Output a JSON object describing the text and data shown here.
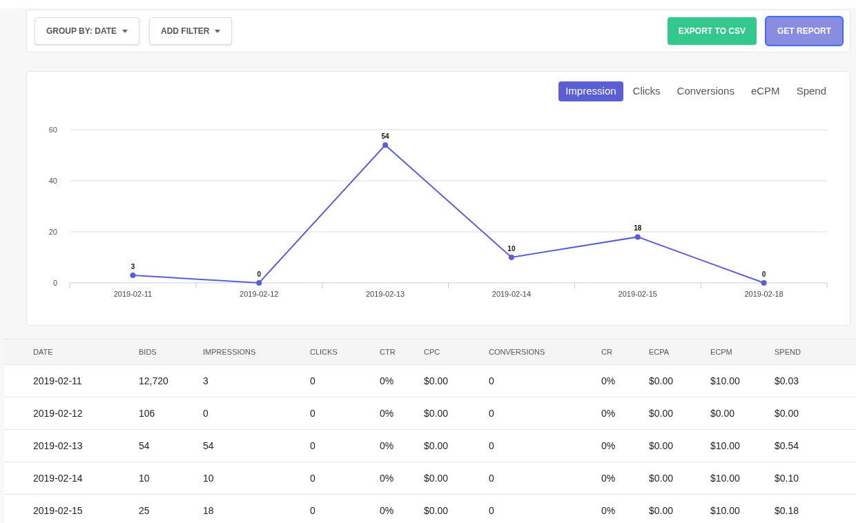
{
  "toolbar": {
    "left_buttons": [
      {
        "label": "GROUP BY: DATE"
      },
      {
        "label": "ADD FILTER"
      }
    ],
    "right_buttons": [
      {
        "label": "EXPORT TO CSV",
        "kind": "export"
      },
      {
        "label": "GET REPORT",
        "kind": "report"
      }
    ]
  },
  "chart_panel": {
    "tabs": [
      {
        "label": "Impression",
        "selected": true
      },
      {
        "label": "Clicks",
        "selected": false
      },
      {
        "label": "Conversions",
        "selected": false
      },
      {
        "label": "eCPM",
        "selected": false
      },
      {
        "label": "Spend",
        "selected": false
      }
    ],
    "chart_data": {
      "type": "line",
      "categories": [
        "2019-02-11",
        "2019-02-12",
        "2019-02-13",
        "2019-02-14",
        "2019-02-15",
        "2019-02-18"
      ],
      "series": [
        {
          "color": "#5b5fd6",
          "marker": "circle",
          "values": [
            3,
            0,
            54,
            10,
            18,
            0
          ]
        }
      ],
      "ylim": [
        0,
        60
      ],
      "yticks": [
        0,
        20,
        40,
        60
      ],
      "data_labels": true
    }
  },
  "table": {
    "columns": [
      "DATE",
      "BIDS",
      "IMPRESSIONS",
      "CLICKS",
      "CTR",
      "CPC",
      "CONVERSIONS",
      "CR",
      "ECPA",
      "ECPM",
      "SPEND"
    ],
    "rows": [
      [
        "2019-02-11",
        "12,720",
        "3",
        "0",
        "0%",
        "$0.00",
        "0",
        "0%",
        "$0.00",
        "$10.00",
        "$0.03"
      ],
      [
        "2019-02-12",
        "106",
        "0",
        "0",
        "0%",
        "$0.00",
        "0",
        "0%",
        "$0.00",
        "$0.00",
        "$0.00"
      ],
      [
        "2019-02-13",
        "54",
        "54",
        "0",
        "0%",
        "$0.00",
        "0",
        "0%",
        "$0.00",
        "$10.00",
        "$0.54"
      ],
      [
        "2019-02-14",
        "10",
        "10",
        "0",
        "0%",
        "$0.00",
        "0",
        "0%",
        "$0.00",
        "$10.00",
        "$0.10"
      ],
      [
        "2019-02-15",
        "25",
        "18",
        "0",
        "0%",
        "$0.00",
        "0",
        "0%",
        "$0.00",
        "$10.00",
        "$0.18"
      ]
    ]
  }
}
